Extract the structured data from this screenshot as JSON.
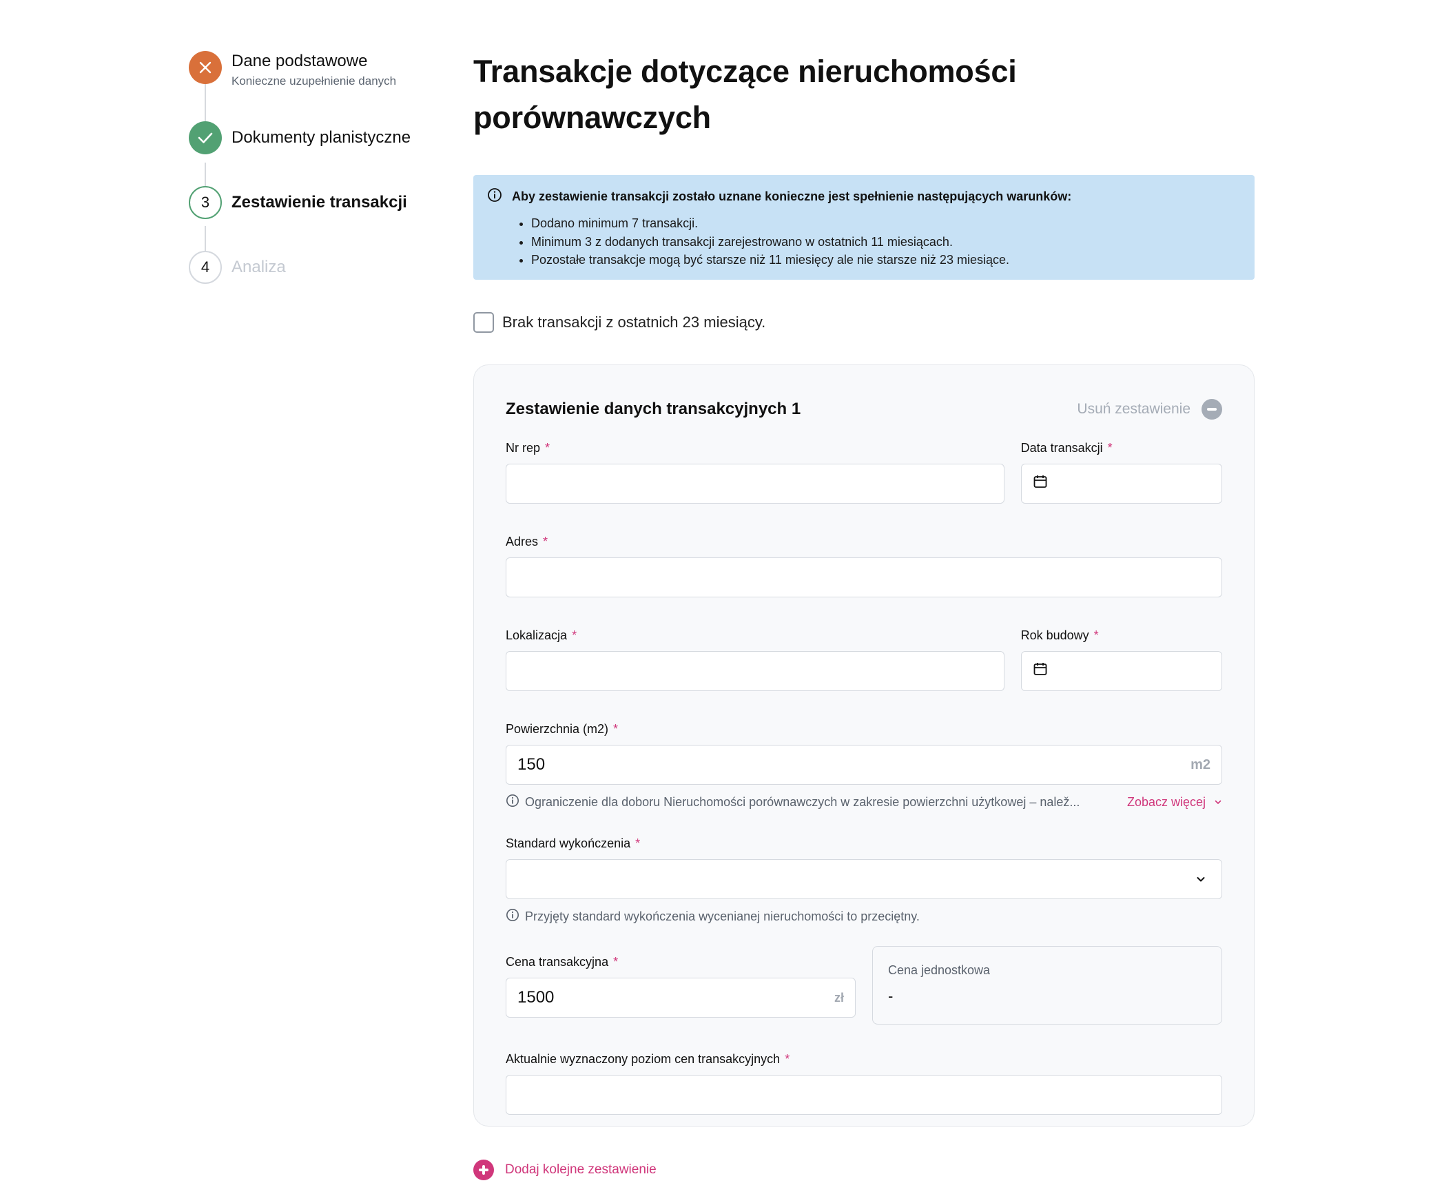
{
  "stepper": [
    {
      "number": "",
      "title": "Dane podstawowe",
      "subtitle": "Konieczne uzupełnienie danych",
      "state": "error",
      "icon": "close-icon"
    },
    {
      "number": "",
      "title": "Dokumenty planistyczne",
      "subtitle": "",
      "state": "done",
      "icon": "check-icon"
    },
    {
      "number": "3",
      "title": "Zestawienie transakcji",
      "subtitle": "",
      "state": "current",
      "icon": ""
    },
    {
      "number": "4",
      "title": "Analiza",
      "subtitle": "",
      "state": "future",
      "icon": ""
    }
  ],
  "page": {
    "title": "Transakcje dotyczące nieruchomości porównawczych"
  },
  "alert": {
    "icon": "info-icon",
    "heading": "Aby zestawienie transakcji zostało uznane konieczne jest spełnienie następujących warunków:",
    "items": [
      "Dodano minimum 7 transakcji.",
      "Minimum 3 z dodanych transakcji zarejestrowano w ostatnich 11 miesiącach.",
      "Pozostałe transakcje mogą być starsze niż 11 miesięcy ale nie starsze niż 23 miesiące."
    ]
  },
  "no_transactions_checkbox": {
    "label": "Brak transakcji z ostatnich 23 miesiący.",
    "checked": false
  },
  "card": {
    "title": "Zestawienie danych transakcyjnych 1",
    "remove_label": "Usuń zestawienie",
    "fields": {
      "nr_rep": {
        "label": "Nr rep",
        "required_mark": "*",
        "value": ""
      },
      "data_transakcji": {
        "label": "Data transakcji",
        "required_mark": "*",
        "value": "",
        "icon": "calendar-icon"
      },
      "adres": {
        "label": "Adres",
        "required_mark": "*",
        "value": ""
      },
      "lokalizacja": {
        "label": "Lokalizacja",
        "required_mark": "*",
        "value": ""
      },
      "rok_budowy": {
        "label": "Rok budowy",
        "required_mark": "*",
        "value": "",
        "icon": "calendar-icon"
      },
      "powierzchnia": {
        "label": "Powierzchnia (m2)",
        "required_mark": "*",
        "value": "150",
        "suffix": "m2",
        "hint": "Ograniczenie dla doboru Nieruchomości porównawczych w zakresie powierzchni użytkowej – nalež...",
        "hint_link": "Zobacz więcej"
      },
      "standard": {
        "label": "Standard wykończenia",
        "required_mark": "*",
        "value": "",
        "hint": "Przyjęty standard wykończenia wycenianej nieruchomości to przeciętny."
      },
      "cena_transakcyjna": {
        "label": "Cena transakcyjna",
        "required_mark": "*",
        "value": "1500",
        "suffix": "zł"
      },
      "cena_jednostkowa": {
        "label": "Cena jednostkowa",
        "value": "-"
      },
      "poziom_cen": {
        "label": "Aktualnie wyznaczony poziom cen transakcyjnych",
        "required_mark": "*",
        "value": ""
      }
    }
  },
  "add_button": {
    "label": "Dodaj kolejne zestawienie"
  },
  "colors": {
    "accent": "#d0377b",
    "success": "#52a173",
    "error": "#d9703a",
    "info_bg": "#c7e1f5"
  }
}
